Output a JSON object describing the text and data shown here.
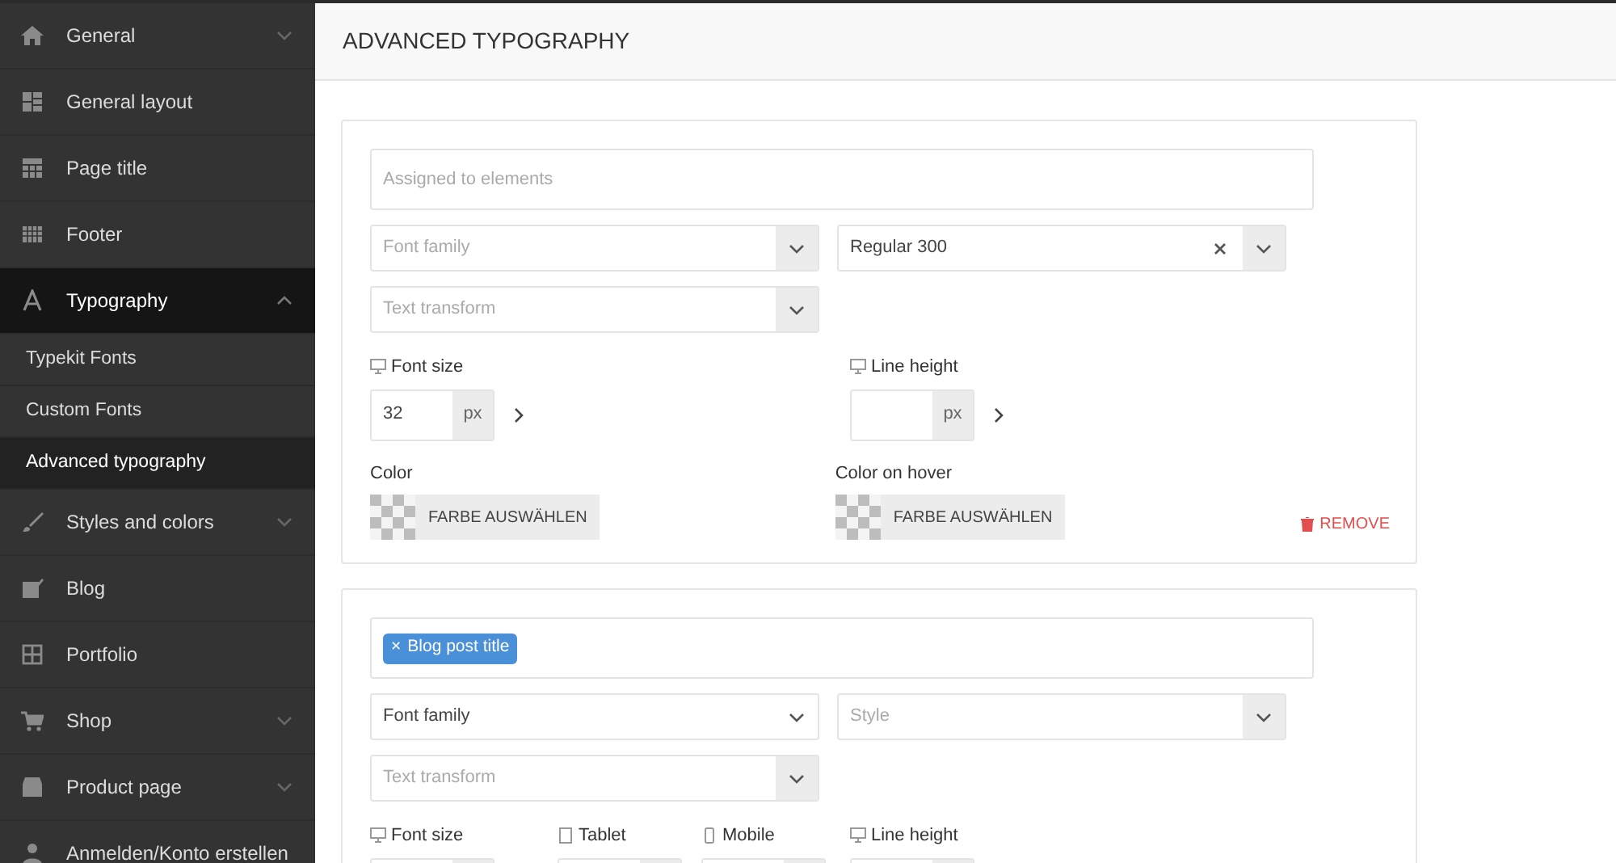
{
  "sidebar": {
    "items": [
      {
        "label": "General",
        "kind": "group",
        "expanded": false
      },
      {
        "label": "General layout",
        "kind": "link"
      },
      {
        "label": "Page title",
        "kind": "link"
      },
      {
        "label": "Footer",
        "kind": "link"
      },
      {
        "label": "Typography",
        "kind": "group",
        "expanded": true,
        "children": [
          {
            "label": "Typekit Fonts",
            "selected": false
          },
          {
            "label": "Custom Fonts",
            "selected": false
          },
          {
            "label": "Advanced typography",
            "selected": true
          }
        ]
      },
      {
        "label": "Styles and colors",
        "kind": "group",
        "expanded": false
      },
      {
        "label": "Blog",
        "kind": "link"
      },
      {
        "label": "Portfolio",
        "kind": "link"
      },
      {
        "label": "Shop",
        "kind": "group",
        "expanded": false
      },
      {
        "label": "Product page",
        "kind": "group",
        "expanded": false
      },
      {
        "label": "Anmelden/Konto erstellen",
        "kind": "link"
      }
    ]
  },
  "page_title": "ADVANCED TYPOGRAPHY",
  "cards": [
    {
      "assigned": {
        "placeholder": "Assigned to elements"
      },
      "font_family": {
        "placeholder": "Font family"
      },
      "style": {
        "value": "Regular 300",
        "clearable": true
      },
      "text_transform": {
        "placeholder": "Text transform"
      },
      "sizes": [
        {
          "label": "Font size",
          "kind": "desktop",
          "value": "32",
          "unit": "px",
          "arrow": true
        },
        {
          "label": "Line height",
          "kind": "desktop",
          "unit": "px",
          "arrow": true
        }
      ],
      "colors": [
        {
          "label": "Color",
          "button": "FARBE AUSWÄHLEN"
        },
        {
          "label": "Color on hover",
          "button": "FARBE AUSWÄHLEN"
        }
      ],
      "remove": "REMOVE"
    },
    {
      "assigned": {
        "tags": [
          {
            "remove": "×",
            "label": "Blog post title"
          }
        ]
      },
      "font_family": {
        "value": "Font family"
      },
      "style": {
        "placeholder": "Style"
      },
      "text_transform": {
        "placeholder": "Text transform"
      },
      "sizes": [
        {
          "label": "Font size",
          "kind": "desktop"
        },
        {
          "label": "Tablet",
          "kind": "tablet"
        },
        {
          "label": "Mobile",
          "kind": "mobile"
        },
        {
          "label": "Line height",
          "kind": "desktop"
        }
      ]
    }
  ]
}
